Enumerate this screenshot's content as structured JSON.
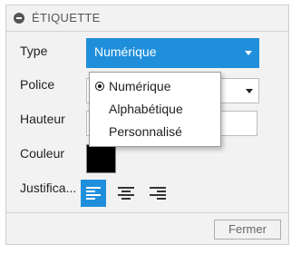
{
  "panel": {
    "title": "ÉTIQUETTE",
    "collapse_icon": "minus-circle-icon"
  },
  "fields": {
    "type_label": "Type",
    "type_value": "Numérique",
    "police_label": "Police",
    "hauteur_label": "Hauteur",
    "couleur_label": "Couleur",
    "couleur_value": "#000000",
    "justification_label": "Justifica..."
  },
  "justification": {
    "options": [
      "align-left-icon",
      "align-center-icon",
      "align-right-icon"
    ],
    "selected": "align-left-icon"
  },
  "dropdown": {
    "items": [
      {
        "label": "Numérique",
        "selected": true
      },
      {
        "label": "Alphabétique",
        "selected": false
      },
      {
        "label": "Personnalisé",
        "selected": false
      }
    ]
  },
  "footer": {
    "close_label": "Fermer"
  },
  "colors": {
    "accent": "#1f8fdc",
    "panel_bg": "#f2f2f2"
  }
}
